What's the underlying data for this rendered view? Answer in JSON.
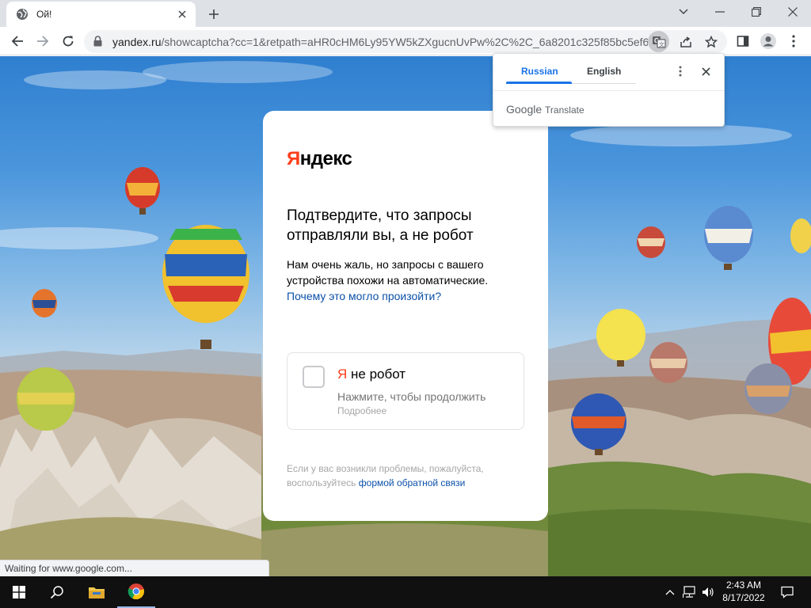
{
  "browser": {
    "tab_title": "Ой!",
    "url_host": "yandex.ru",
    "url_path": "/showcaptcha?cc=1&retpath=aHR0cHM6Ly95YW5kZXgucnUvPw%2C%2C_6a8201c325f85bc5ef6..."
  },
  "translate": {
    "source_tab": "Russian",
    "target_tab": "English",
    "brand_google": "Google",
    "brand_translate": "Translate"
  },
  "captcha": {
    "logo_first": "Я",
    "logo_rest": "ндекс",
    "heading": "Подтвердите, что запросы отправляли вы, а не робот",
    "description": "Нам очень жаль, но запросы с вашего устройства похожи на автоматические.",
    "description_link": "Почему это могло произойти?",
    "checkbox_ya": "Я",
    "checkbox_label": "не робот",
    "checkbox_hint": "Нажмите, чтобы продолжить",
    "checkbox_more": "Подробнее",
    "footer_text": "Если у вас возникли проблемы, пожалуйста, воспользуйтесь",
    "footer_link": "формой обратной связи"
  },
  "status_bar": "Waiting for www.google.com...",
  "taskbar": {
    "time": "2:43 AM",
    "date": "8/17/2022"
  }
}
